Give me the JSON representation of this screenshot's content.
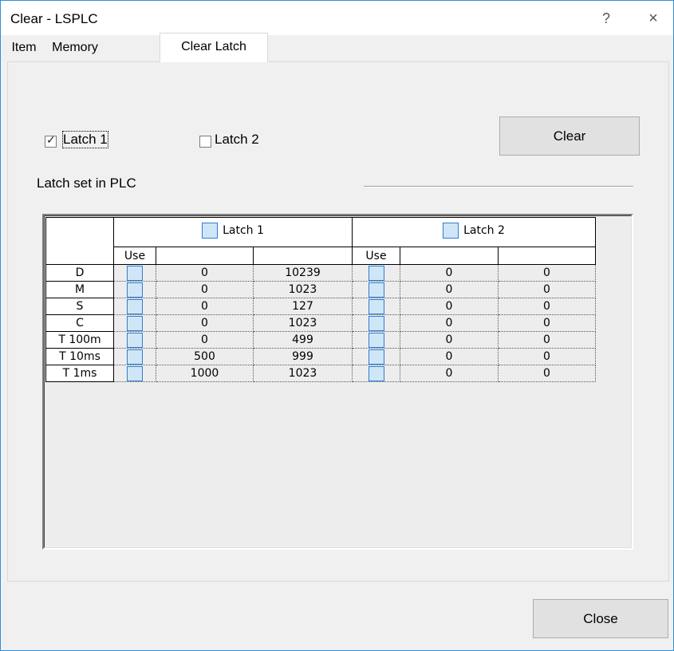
{
  "window": {
    "title": "Clear - LSPLC",
    "help_glyph": "?",
    "close_glyph": "×"
  },
  "tabs": [
    {
      "label": "Item"
    },
    {
      "label": "Memory"
    },
    {
      "label": "Clear Latch"
    }
  ],
  "options": {
    "latch1_label": "Latch 1",
    "latch1_checked": true,
    "latch2_label": "Latch 2",
    "latch2_checked": false
  },
  "clear_button": "Clear",
  "caption": "Latch set in  PLC",
  "grid": {
    "group_headers": [
      "Latch 1",
      "Latch 2"
    ],
    "use_label": "Use",
    "rows": [
      {
        "name": "D",
        "l1_start": "0",
        "l1_end": "10239",
        "l2_start": "0",
        "l2_end": "0"
      },
      {
        "name": "M",
        "l1_start": "0",
        "l1_end": "1023",
        "l2_start": "0",
        "l2_end": "0"
      },
      {
        "name": "S",
        "l1_start": "0",
        "l1_end": "127",
        "l2_start": "0",
        "l2_end": "0"
      },
      {
        "name": "C",
        "l1_start": "0",
        "l1_end": "1023",
        "l2_start": "0",
        "l2_end": "0"
      },
      {
        "name": "T 100m",
        "l1_start": "0",
        "l1_end": "499",
        "l2_start": "0",
        "l2_end": "0"
      },
      {
        "name": "T 10ms",
        "l1_start": "500",
        "l1_end": "999",
        "l2_start": "0",
        "l2_end": "0"
      },
      {
        "name": "T 1ms",
        "l1_start": "1000",
        "l1_end": "1023",
        "l2_start": "0",
        "l2_end": "0"
      }
    ]
  },
  "close_button": "Close",
  "colors": {
    "accent_border": "#2f8fd8",
    "checkbox_fill": "#cfe6f8",
    "checkbox_border": "#2d7dd2"
  }
}
